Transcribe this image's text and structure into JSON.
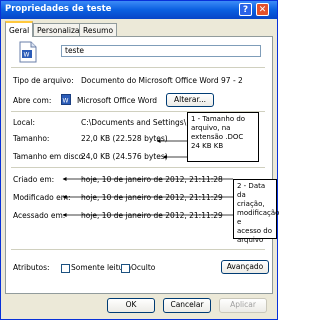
{
  "window": {
    "title": "Propriedades de teste"
  },
  "titlebar": {
    "help_glyph": "?",
    "close_glyph": "✕"
  },
  "tabs": [
    {
      "label": "Geral",
      "active": true
    },
    {
      "label": "Personalizar",
      "active": false
    },
    {
      "label": "Resumo",
      "active": false
    }
  ],
  "file": {
    "name": "teste",
    "icon": "word-document-icon"
  },
  "rows": {
    "type_label": "Tipo de arquivo:",
    "type_value": "Documento do Microsoft Office Word 97 - 2",
    "open_label": "Abre com:",
    "open_value": "Microsoft Office Word",
    "change_button": "Alterar...",
    "location_label": "Local:",
    "location_value": "C:\\Documents and Settings\\",
    "size_label": "Tamanho:",
    "size_value": "22,0 KB (22.528 bytes)",
    "disk_label": "Tamanho em disco:",
    "disk_value": "24,0 KB (24.576 bytes)",
    "created_label": "Criado em:",
    "created_value": "hoje, 10 de janeiro de 2012, 21:11:28",
    "modified_label": "Modificado em:",
    "modified_value": "hoje, 10 de janeiro de 2012, 21:11:29",
    "accessed_label": "Acessado em:",
    "accessed_value": "hoje, 10 de janeiro de 2012, 21:11:29",
    "attributes_label": "Atributos:",
    "readonly_label": "Somente leitura",
    "hidden_label": "Oculto",
    "advanced_button": "Avançado"
  },
  "annotations": {
    "note1_lines": [
      "1 - Tamanho do",
      "arquivo, na",
      "extensão .DOC",
      "24 KB KB"
    ],
    "note2_lines": [
      "2 - Data da",
      "criação,",
      "modificação e",
      "acesso do",
      "arquivo"
    ]
  },
  "footer": {
    "ok": "OK",
    "cancel": "Cancelar",
    "apply": "Aplicar"
  }
}
